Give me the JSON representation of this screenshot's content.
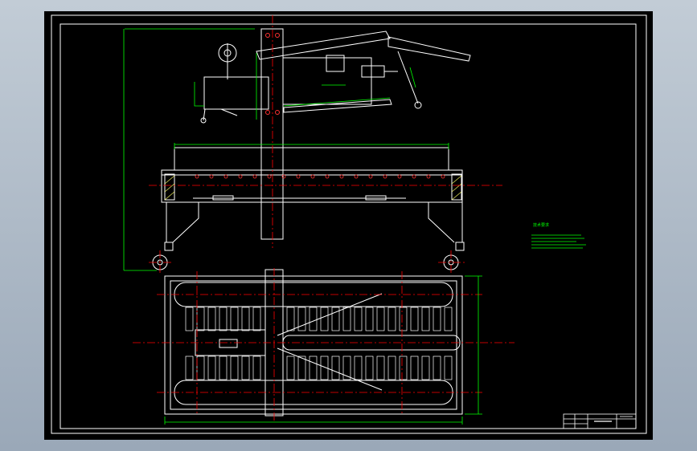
{
  "drawing": {
    "notes_heading": "技术要求",
    "notes_lines": [
      "",
      "",
      "",
      ""
    ],
    "title_block": {
      "drawing_name": "",
      "scale": ""
    }
  },
  "colors": {
    "background": "#000000",
    "outline": "#ffffff",
    "dimension": "#00ff00",
    "centerline": "#ff0000",
    "hole_marker": "#ff3333"
  }
}
